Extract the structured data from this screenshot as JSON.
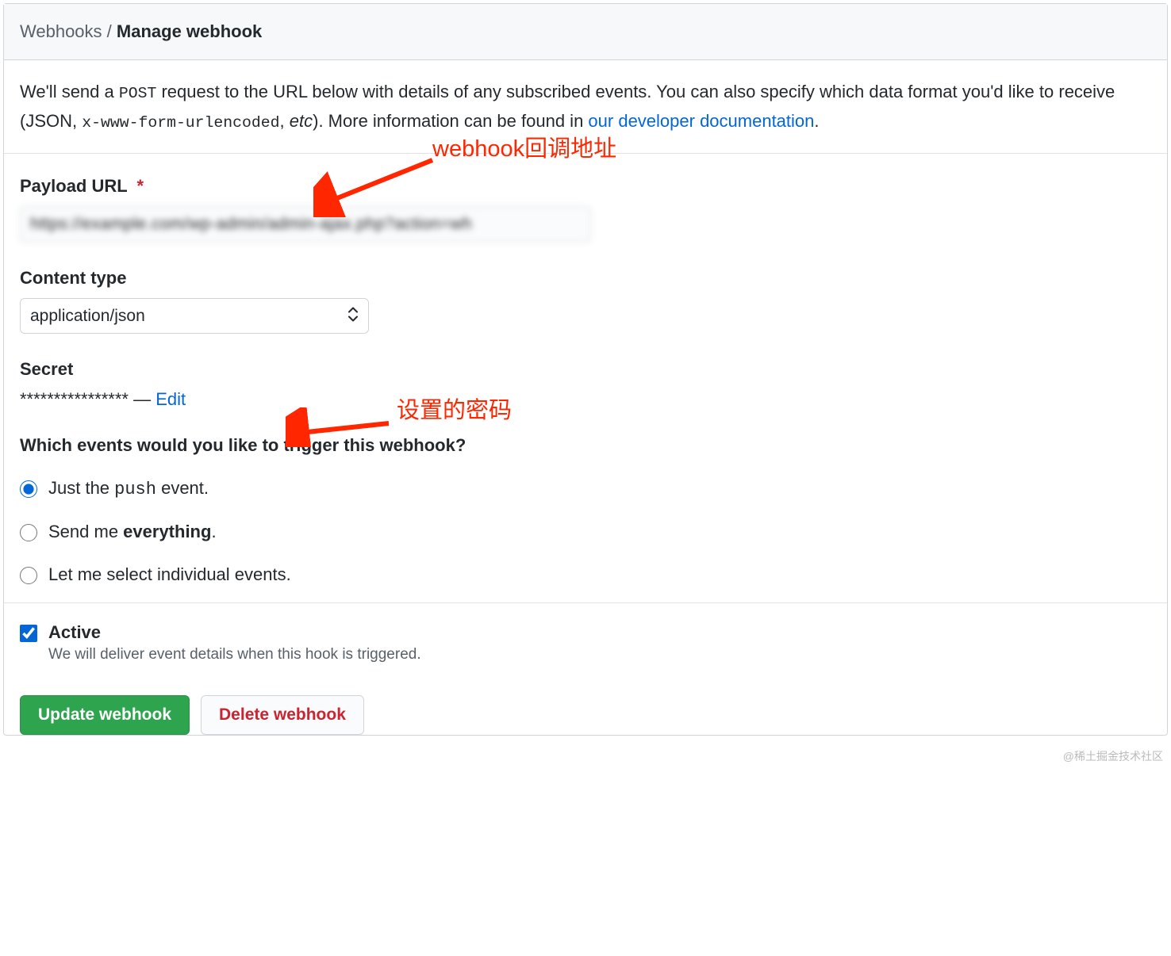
{
  "breadcrumb": {
    "parent": "Webhooks",
    "separator": " / ",
    "current": "Manage webhook"
  },
  "description": {
    "pre": "We'll send a ",
    "post_method": "POST",
    "mid1": " request to the URL below with details of any subscribed events. You can also specify which data format you'd like to receive (JSON, ",
    "code_format": "x-www-form-urlencoded",
    "mid2": ", ",
    "etc": "etc",
    "mid3": "). More information can be found in ",
    "link_text": "our developer documentation",
    "period": "."
  },
  "form": {
    "payload_url_label": "Payload URL",
    "required_mark": "*",
    "payload_url_value": "https://example.com/wp-admin/admin-ajax.php?action=wh",
    "content_type_label": "Content type",
    "content_type_value": "application/json",
    "secret_label": "Secret",
    "secret_masked": "****************",
    "secret_dash": " — ",
    "secret_edit": "Edit",
    "events_heading": "Which events would you like to trigger this webhook?",
    "event_options": {
      "push": {
        "prefix": "Just the ",
        "code": "push",
        "suffix": " event."
      },
      "everything": {
        "prefix": "Send me ",
        "strong": "everything",
        "suffix": "."
      },
      "individual": {
        "text": "Let me select individual events."
      }
    }
  },
  "active": {
    "label": "Active",
    "description": "We will deliver event details when this hook is triggered."
  },
  "buttons": {
    "update": "Update webhook",
    "delete": "Delete webhook"
  },
  "annotations": {
    "callback": "webhook回调地址",
    "password": "设置的密码"
  },
  "watermark": "@稀土掘金技术社区"
}
